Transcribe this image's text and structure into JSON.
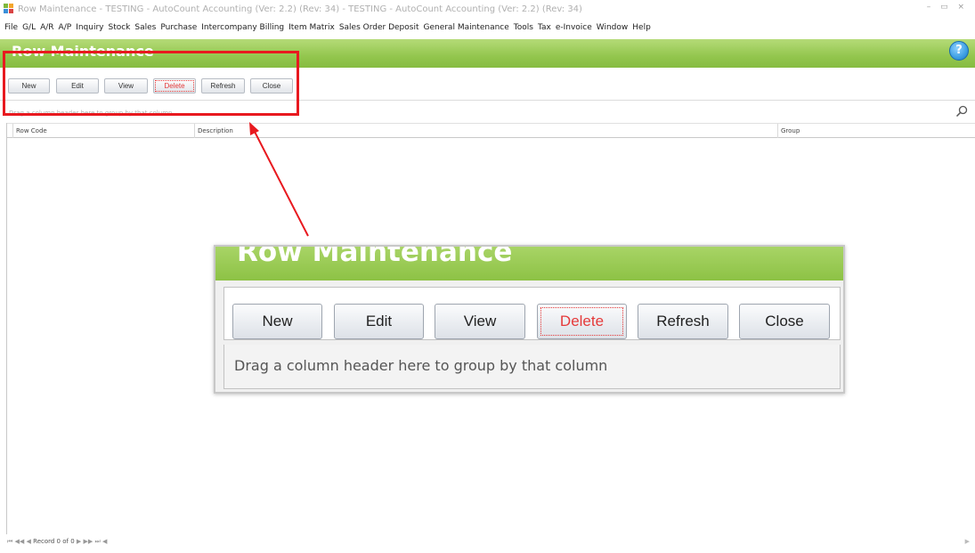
{
  "window": {
    "title": "Row Maintenance - TESTING - AutoCount Accounting (Ver: 2.2) (Rev: 34) - TESTING - AutoCount Accounting (Ver: 2.2) (Rev: 34)",
    "controls": "– ▭ ×"
  },
  "menu": {
    "items": [
      "File",
      "G/L",
      "A/R",
      "A/P",
      "Inquiry",
      "Stock",
      "Sales",
      "Purchase",
      "Intercompany Billing",
      "Item Matrix",
      "Sales Order Deposit",
      "General Maintenance",
      "Tools",
      "Tax",
      "e-Invoice",
      "Window",
      "Help"
    ]
  },
  "panel": {
    "title": "Row Maintenance",
    "help_label": "?"
  },
  "toolbar": {
    "new_label": "New",
    "edit_label": "Edit",
    "view_label": "View",
    "delete_label": "Delete",
    "refresh_label": "Refresh",
    "close_label": "Close"
  },
  "grid": {
    "groupby_hint": "Drag a column header here to group by that column",
    "columns": [
      "Row Code",
      "Description",
      "Group"
    ]
  },
  "navigator": {
    "buttons_left": "⏮ ◀◀ ◀",
    "record_text": "Record 0 of 0",
    "buttons_right": "▶ ▶▶ ⏭ ◀",
    "scroll_right": "▶"
  },
  "colors": {
    "header_green": "#8dc245",
    "annotation_red": "#e8191f",
    "delete_red": "#e53a3a"
  }
}
